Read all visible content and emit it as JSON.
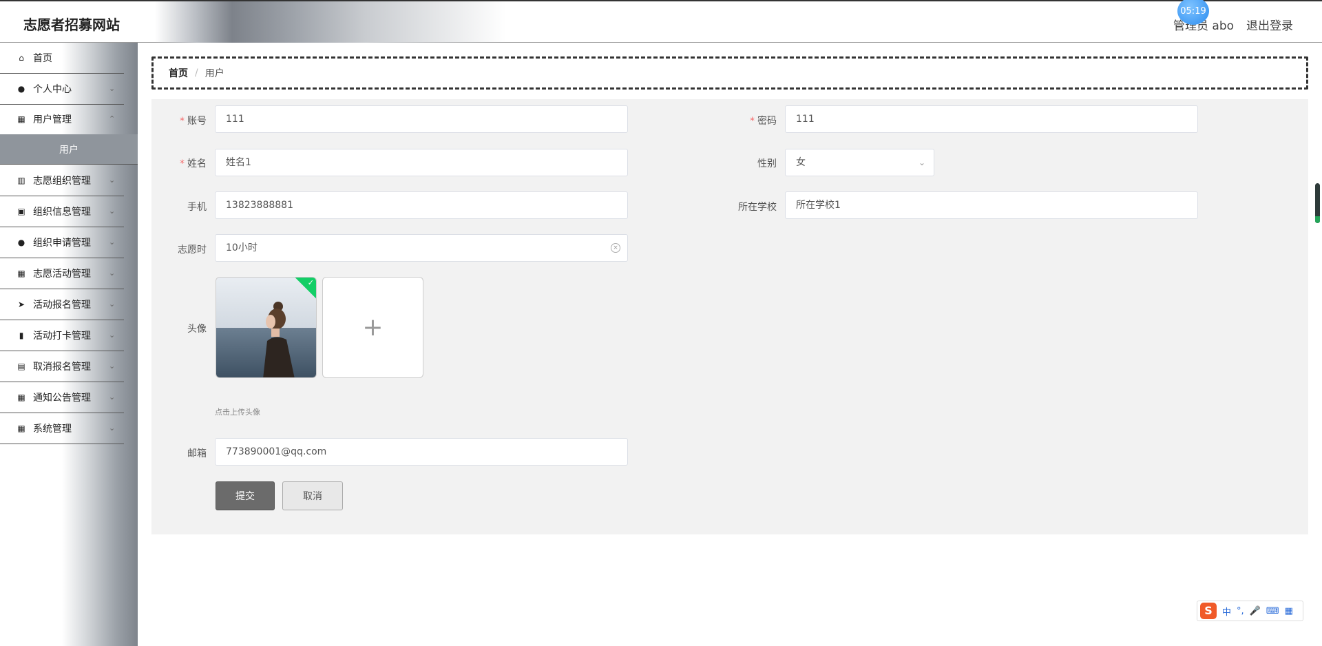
{
  "header": {
    "brand": "志愿者招募网站",
    "user": "管理员 abo",
    "logout": "退出登录",
    "clock": "05:19"
  },
  "sidebar": {
    "items": [
      {
        "label": "首页",
        "icon": "home-icon"
      },
      {
        "label": "个人中心",
        "icon": "user-icon"
      },
      {
        "label": "用户管理",
        "icon": "grid-icon"
      },
      {
        "label": "志愿组织管理",
        "icon": "library-icon"
      },
      {
        "label": "组织信息管理",
        "icon": "clipboard-icon"
      },
      {
        "label": "组织申请管理",
        "icon": "user-icon"
      },
      {
        "label": "志愿活动管理",
        "icon": "grid-icon"
      },
      {
        "label": "活动报名管理",
        "icon": "send-icon"
      },
      {
        "label": "活动打卡管理",
        "icon": "bar-chart-icon"
      },
      {
        "label": "取消报名管理",
        "icon": "line-chart-icon"
      },
      {
        "label": "通知公告管理",
        "icon": "grid-icon"
      },
      {
        "label": "系统管理",
        "icon": "grid-icon"
      }
    ],
    "active_sub": "用户"
  },
  "breadcrumb": {
    "home": "首页",
    "separator": "/",
    "current": "用户"
  },
  "form": {
    "account": {
      "label": "账号",
      "value": "111"
    },
    "password": {
      "label": "密码",
      "value": "111"
    },
    "name": {
      "label": "姓名",
      "value": "姓名1"
    },
    "gender": {
      "label": "性别",
      "value": "女"
    },
    "phone": {
      "label": "手机",
      "value": "13823888881"
    },
    "school": {
      "label": "所在学校",
      "value": "所在学校1"
    },
    "hours": {
      "label": "志愿时",
      "value": "10小时"
    },
    "avatar": {
      "label": "头像",
      "tip": "点击上传头像",
      "upload_symbol": "+"
    },
    "email": {
      "label": "邮箱",
      "value": "773890001@qq.com"
    },
    "submit": "提交",
    "cancel": "取消",
    "required_mark": "*"
  },
  "ime": {
    "logo": "S",
    "lang": "中",
    "punct": "°,"
  },
  "colors": {
    "accent": "#6b6b6b",
    "required": "#f56c6c",
    "success": "#13ce66"
  }
}
